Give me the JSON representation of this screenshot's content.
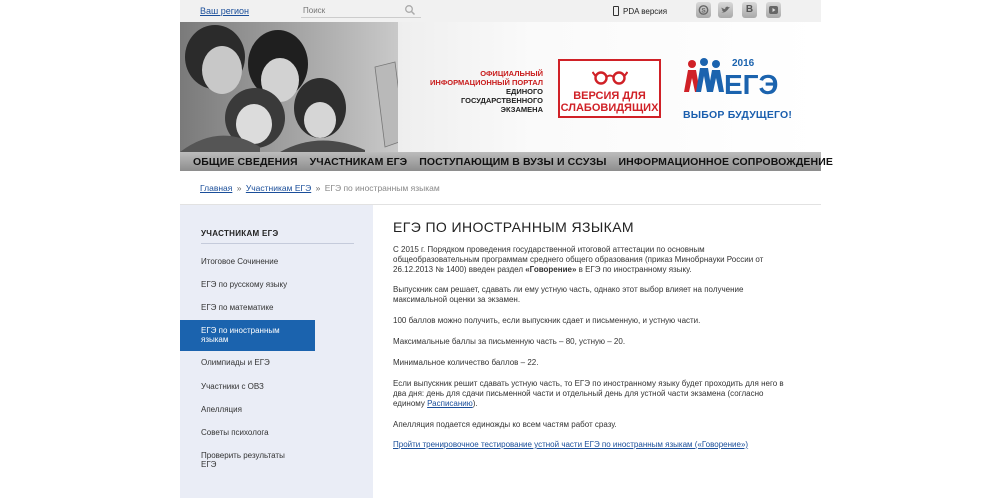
{
  "topbar": {
    "region_link": "Ваш регион",
    "search_placeholder": "Поиск",
    "pda_label": "PDA версия",
    "social": [
      "skype-icon",
      "twitter-icon",
      "vk-icon",
      "youtube-icon"
    ],
    "social_glyphs": {
      "vk": "B"
    }
  },
  "header": {
    "portal_line1": "ОФИЦИАЛЬНЫЙ",
    "portal_line2": "ИНФОРМАЦИОННЫЙ ПОРТАЛ",
    "portal_line3": "ЕДИНОГО ГОСУДАРСТВЕННОГО",
    "portal_line4": "ЭКЗАМЕНА",
    "vision_line1": "ВЕРСИЯ ДЛЯ",
    "vision_line2": "СЛАБОВИДЯЩИХ",
    "logo_year": "2016",
    "logo_text": "ЕГЭ",
    "slogan": "ВЫБОР БУДУЩЕГО!"
  },
  "nav": {
    "items": [
      "ОБЩИЕ СВЕДЕНИЯ",
      "УЧАСТНИКАМ ЕГЭ",
      "ПОСТУПАЮЩИМ В ВУЗЫ И ССУЗЫ",
      "ИНФОРМАЦИОННОЕ СОПРОВОЖДЕНИЕ"
    ]
  },
  "breadcrumb": {
    "home": "Главная",
    "section": "Участникам ЕГЭ",
    "sep": "»",
    "current": "ЕГЭ по иностранным языкам"
  },
  "sidebar": {
    "title": "УЧАСТНИКАМ ЕГЭ",
    "items": [
      "Итоговое Сочинение",
      "ЕГЭ по русскому языку",
      "ЕГЭ по математике",
      "ЕГЭ по иностранным языкам",
      "Олимпиады и ЕГЭ",
      "Участники с ОВЗ",
      "Апелляция",
      "Советы психолога",
      "Проверить результаты ЕГЭ"
    ],
    "active_index": 3
  },
  "main": {
    "title": "ЕГЭ ПО ИНОСТРАННЫМ ЯЗЫКАМ",
    "p1_a": "С 2015 г. Порядком проведения государственной итоговой аттестации по основным общеобразовательным программам среднего общего образования (приказ Минобрнауки России от 26.12.2013 № 1400) введен раздел ",
    "p1_bold": "«Говорение»",
    "p1_b": " в ЕГЭ по иностранному языку.",
    "p2": "Выпускник сам решает, сдавать ли ему устную часть, однако этот выбор влияет на получение максимальной оценки за экзамен.",
    "p3": "100 баллов можно получить, если выпускник сдает и письменную, и устную части.",
    "p4": "Максимальные баллы за письменную часть – 80, устную – 20.",
    "p5": "Минимальное количество баллов – 22.",
    "p6_a": "Если выпускник решит сдавать устную часть, то ЕГЭ по иностранному языку будет проходить для него в два дня: день для сдачи письменной части и отдельный день для устной части экзамена (согласно единому ",
    "p6_link": "Расписанию",
    "p6_b": ").",
    "p7": "Апелляция подается единожды ко всем частям работ сразу.",
    "p8_link": "Пройти тренировочное тестирование устной части ЕГЭ по иностранным языкам («Говорение»)"
  },
  "colors": {
    "accent_blue": "#1b63ae",
    "link_blue": "#1a4e9a",
    "vision_red": "#d02127",
    "sidebar_bg": "#eaedf6"
  }
}
